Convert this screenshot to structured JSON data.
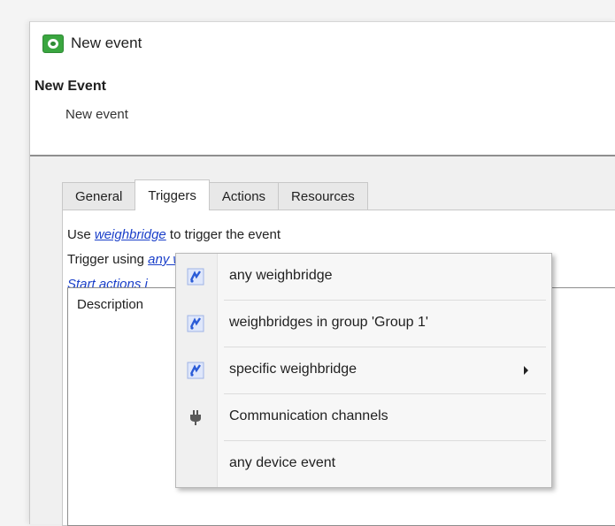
{
  "window": {
    "title": "New event"
  },
  "header": {
    "title": "New Event",
    "subtitle": "New event"
  },
  "tabs": [
    {
      "label": "General"
    },
    {
      "label": "Triggers",
      "active": true
    },
    {
      "label": "Actions"
    },
    {
      "label": "Resources"
    }
  ],
  "triggers": {
    "line1": {
      "prefix": "Use",
      "link": "weighbridge",
      "suffix": "to trigger the event"
    },
    "line2": {
      "prefix": "Trigger using",
      "link": "any weighbridge"
    },
    "line3": {
      "link": "Start actions i"
    },
    "description_label": "Description"
  },
  "context_menu": {
    "items": [
      {
        "label": "any weighbridge",
        "icon": "weighbridge-icon"
      },
      {
        "label": "weighbridges in group 'Group 1'",
        "icon": "weighbridge-icon"
      },
      {
        "label": "specific weighbridge",
        "icon": "weighbridge-icon",
        "submenu": true
      },
      {
        "label": "Communication channels",
        "icon": "plug-icon"
      },
      {
        "label": "any device event",
        "icon": ""
      }
    ]
  },
  "colors": {
    "accent": "#1a3fc9",
    "app_icon": "#3aa640",
    "weighbridge_icon": "#2a5bd7"
  }
}
